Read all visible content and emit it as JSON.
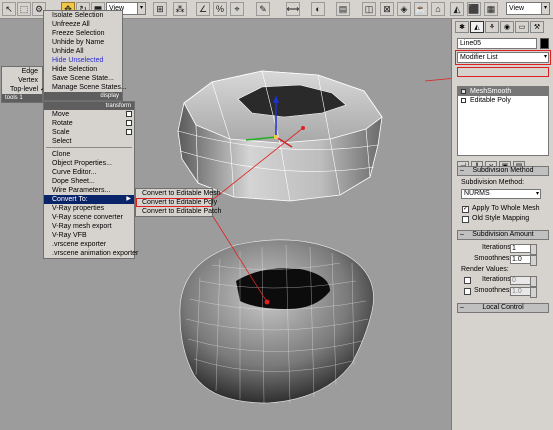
{
  "toolbar": {
    "view_combo_left": "View",
    "view_combo_right": "View",
    "ref_coord": "View"
  },
  "quad_menu_left": {
    "items": [
      "Edge",
      "Vertex",
      "Top-level ✓"
    ],
    "header": "tools 1"
  },
  "quad_menu_top": {
    "items": [
      "Isolate Selection",
      "Unfreeze All",
      "Freeze Selection",
      "Unhide by Name",
      "Unhide All",
      "Hide Unselected",
      "Hide Selection",
      "Save Scene State...",
      "Manage Scene States..."
    ],
    "header_left": "",
    "header_display": "display"
  },
  "quad_menu_bottom": {
    "header_transform": "transform",
    "items": [
      "Move",
      "Rotate",
      "Scale",
      "Select",
      "Clone",
      "Object Properties...",
      "Curve Editor...",
      "Dope Sheet...",
      "Wire Parameters...",
      "Convert To:",
      "V-Ray properties",
      "V-Ray scene converter",
      "V-Ray mesh export",
      "V-Ray VFB",
      ".vrscene exporter",
      ".vrscene animation exporter"
    ]
  },
  "submenu": {
    "items": [
      "Convert to Editable Mesh",
      "Convert to Editable Poly",
      "Convert to Editable Patch"
    ]
  },
  "panel": {
    "object_name": "Line05",
    "modifier_list": "Modifier List",
    "stack": [
      "MeshSmooth",
      "Editable Poly"
    ],
    "subdivision_method_title": "Subdivision Method",
    "subdivision_method_label": "Subdivision Method:",
    "subdivision_method_value": "NURMS",
    "apply_whole_mesh": "Apply To Whole Mesh",
    "old_style_mapping": "Old Style Mapping",
    "subdivision_amount_title": "Subdivision Amount",
    "iterations_label": "Iterations:",
    "iterations_value": "1",
    "smoothness_label": "Smoothness:",
    "smoothness_value": "1.0",
    "render_values_label": "Render Values:",
    "render_iterations_value": "0",
    "render_smoothness_value": "1.0",
    "local_control_title": "Local Control"
  },
  "colors": {
    "accent": "#f2c84b",
    "selection": "#0a246a",
    "annotation": "#e02020"
  }
}
